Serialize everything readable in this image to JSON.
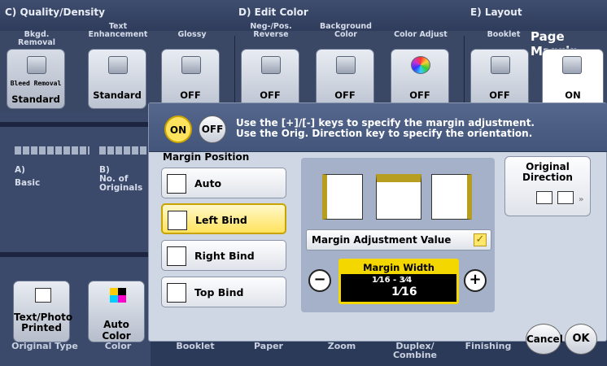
{
  "header": {
    "groups": [
      {
        "label": "C)  Quality/Density"
      },
      {
        "label": "D)  Edit Color"
      },
      {
        "label": "E)  Layout"
      }
    ],
    "sub_labels": [
      "Bkgd. Removal",
      "Text Enhancement",
      "Glossy",
      "Neg-/Pos. Reverse",
      "Background Color",
      "Color Adjust",
      "Booklet"
    ],
    "title": "Page Margin"
  },
  "function_buttons": [
    {
      "label": "Standard",
      "top_text": "Bleed Removal"
    },
    {
      "label": "Standard"
    },
    {
      "label": "OFF"
    },
    {
      "label": "OFF"
    },
    {
      "label": "OFF"
    },
    {
      "label": "OFF"
    },
    {
      "label": "OFF"
    },
    {
      "label": "ON"
    }
  ],
  "left_panel": {
    "a_label": "A)",
    "a_text": "Basic",
    "b_label": "B)",
    "b_text": "No. of Originals",
    "btn1": "Text/Photo Printed",
    "btn2": "Auto Color"
  },
  "bottom_tabs": [
    "Original Type",
    "Color",
    "Booklet",
    "Paper",
    "Zoom",
    "Duplex/ Combine",
    "Finishing"
  ],
  "dialog": {
    "on_label": "ON",
    "off_label": "OFF",
    "message_line1": "Use the [+]/[-] keys to specify the margin adjustment.",
    "message_line2": "Use the Orig. Direction key to specify the orientation.",
    "margin_position_title": "Margin Position",
    "positions": [
      "Auto",
      "Left Bind",
      "Right Bind",
      "Top Bind"
    ],
    "margin_adjustment_label": "Margin Adjustment Value",
    "margin_width_title": "Margin Width",
    "margin_width_range": "1⁄16 - 3⁄4",
    "margin_width_value": "1⁄16",
    "original_direction": "Original Direction",
    "cancel": "Cancel",
    "ok": "OK"
  },
  "colors": {
    "accent": "#f5d700",
    "background": "#2c3a5a"
  }
}
